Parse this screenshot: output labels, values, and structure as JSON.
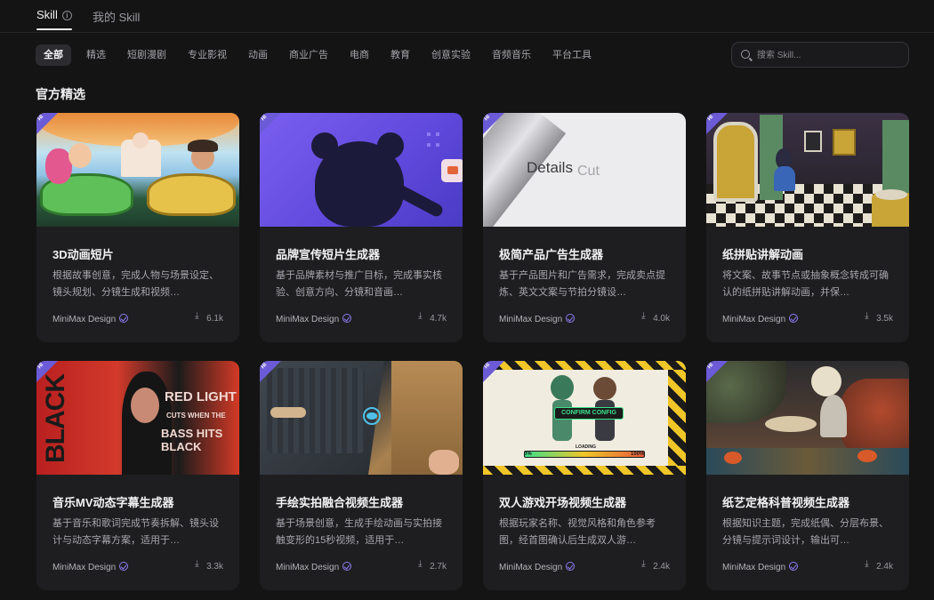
{
  "top_tabs": [
    {
      "label": "Skill",
      "active": true
    },
    {
      "label": "我的 Skill",
      "active": false
    }
  ],
  "categories": [
    "全部",
    "精选",
    "短剧漫剧",
    "专业影视",
    "动画",
    "商业广告",
    "电商",
    "教育",
    "创意实验",
    "音频音乐",
    "平台工具"
  ],
  "active_category": "全部",
  "search": {
    "placeholder": "搜索 Skill..."
  },
  "section_title": "官方精选",
  "badge": "HI",
  "cards": [
    {
      "title": "3D动画短片",
      "desc": "根据故事创意，完成人物与场景设定、镜头规划、分镜生成和视频…",
      "author": "MiniMax Design",
      "downloads": "6.1k"
    },
    {
      "title": "品牌宣传短片生成器",
      "desc": "基于品牌素材与推广目标，完成事实核验、创意方向、分镜和音画…",
      "author": "MiniMax Design",
      "downloads": "4.7k"
    },
    {
      "title": "极简产品广告生成器",
      "desc": "基于产品图片和广告需求，完成卖点提炼、英文文案与节拍分镜设…",
      "author": "MiniMax Design",
      "downloads": "4.0k"
    },
    {
      "title": "纸拼贴讲解动画",
      "desc": "将文案、故事节点或抽象概念转成可确认的纸拼贴讲解动画，并保…",
      "author": "MiniMax Design",
      "downloads": "3.5k"
    },
    {
      "title": "音乐MV动态字幕生成器",
      "desc": "基于音乐和歌词完成节奏拆解、镜头设计与动态字幕方案，适用于…",
      "author": "MiniMax Design",
      "downloads": "3.3k"
    },
    {
      "title": "手绘实拍融合视频生成器",
      "desc": "基于场景创意，生成手绘动画与实拍接触变形的15秒视频，适用于…",
      "author": "MiniMax Design",
      "downloads": "2.7k"
    },
    {
      "title": "双人游戏开场视频生成器",
      "desc": "根据玩家名称、视觉风格和角色参考图，经首图确认后生成双人游…",
      "author": "MiniMax Design",
      "downloads": "2.4k"
    },
    {
      "title": "纸艺定格科普视频生成器",
      "desc": "根据知识主题，完成纸偶、分层布景、分镜与提示词设计，输出可…",
      "author": "MiniMax Design",
      "downloads": "2.4k"
    }
  ],
  "thumb_text": {
    "details": "Details",
    "cut": "Cut",
    "mv_side": "BLACK",
    "mv_line1": "RED LIGHT",
    "mv_line2": "CUTS WHEN THE",
    "mv_line3": "BASS HITS BLACK",
    "game_confirm": "CONFIRM CONFIG",
    "game_loading": "LOADING",
    "game_pct_start": "0%",
    "game_pct_end": "100%"
  },
  "colors": {
    "background": "#141415",
    "card": "#1e1e20",
    "accent": "#6b5bd6",
    "verified": "#8b7cf0"
  }
}
